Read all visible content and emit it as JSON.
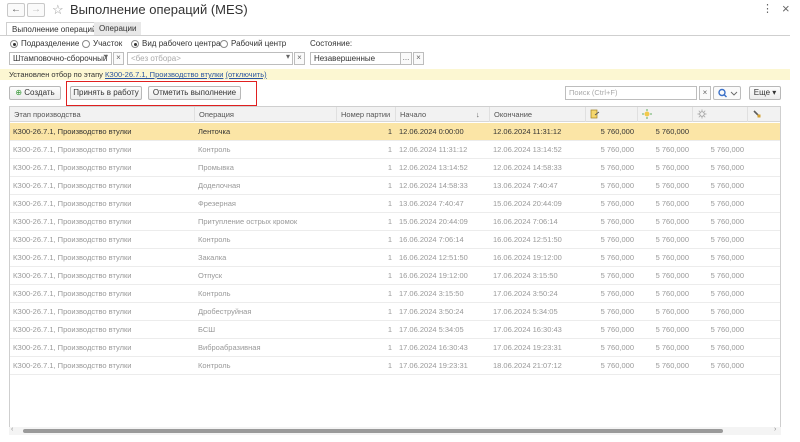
{
  "window": {
    "title": "Выполнение операций (MES)",
    "back": "←",
    "forward": "→",
    "star": "☆",
    "more": "⋮",
    "close": "×"
  },
  "tabs": [
    {
      "label": "Выполнение операций",
      "active": true
    },
    {
      "label": "Операции",
      "active": false
    }
  ],
  "filter": {
    "radios": [
      {
        "label": "Подразделение",
        "checked": true
      },
      {
        "label": "Участок",
        "checked": false
      },
      {
        "label": "Вид рабочего центра",
        "checked": true
      },
      {
        "label": "Рабочий центр",
        "checked": false
      }
    ],
    "subdivision_value": "Штамповочно-сборочный",
    "workcenter_placeholder": "<без отбора>",
    "state_label": "Состояние:",
    "state_value": "Незавершенные",
    "dropdown_glyph": "▾",
    "clear_glyph": "×",
    "select_glyph": "..."
  },
  "notice": {
    "prefix": "Установлен отбор по этапу ",
    "link": "КЗ00-26.7.1, Производство втулки",
    "suffix_link": "(отключить)"
  },
  "toolbar": {
    "create": "Создать",
    "accept": "Принять в работу",
    "mark_done": "Отметить выполнение",
    "search_placeholder": "Поиск (Ctrl+F)",
    "search_clear": "×",
    "search_icon": "magnifier-icon",
    "more": "Еще ▾"
  },
  "table": {
    "columns": [
      "Этап производства",
      "Операция",
      "Номер партии",
      "Начало",
      "Окончание"
    ],
    "sort_glyph": "↓",
    "icon_columns": [
      "document-icon",
      "add-star-icon",
      "gear-spark-icon",
      "tool-icon"
    ],
    "rows": [
      {
        "stage": "КЗ00-26.7.1, Производство втулки",
        "op": "Ленточка",
        "batch": "1",
        "start": "12.06.2024 0:00:00",
        "end": "12.06.2024 11:31:12",
        "v1": "5 760,000",
        "v2": "5 760,000",
        "v3": ""
      },
      {
        "stage": "КЗ00-26.7.1, Производство втулки",
        "op": "Контроль",
        "batch": "1",
        "start": "12.06.2024 11:31:12",
        "end": "12.06.2024 13:14:52",
        "v1": "5 760,000",
        "v2": "5 760,000",
        "v3": "5 760,000"
      },
      {
        "stage": "КЗ00-26.7.1, Производство втулки",
        "op": "Промывка",
        "batch": "1",
        "start": "12.06.2024 13:14:52",
        "end": "12.06.2024 14:58:33",
        "v1": "5 760,000",
        "v2": "5 760,000",
        "v3": "5 760,000"
      },
      {
        "stage": "КЗ00-26.7.1, Производство втулки",
        "op": "Доделочная",
        "batch": "1",
        "start": "12.06.2024 14:58:33",
        "end": "13.06.2024 7:40:47",
        "v1": "5 760,000",
        "v2": "5 760,000",
        "v3": "5 760,000"
      },
      {
        "stage": "КЗ00-26.7.1, Производство втулки",
        "op": "Фрезерная",
        "batch": "1",
        "start": "13.06.2024 7:40:47",
        "end": "15.06.2024 20:44:09",
        "v1": "5 760,000",
        "v2": "5 760,000",
        "v3": "5 760,000"
      },
      {
        "stage": "КЗ00-26.7.1, Производство втулки",
        "op": "Притупление острых кромок",
        "batch": "1",
        "start": "15.06.2024 20:44:09",
        "end": "16.06.2024 7:06:14",
        "v1": "5 760,000",
        "v2": "5 760,000",
        "v3": "5 760,000"
      },
      {
        "stage": "КЗ00-26.7.1, Производство втулки",
        "op": "Контроль",
        "batch": "1",
        "start": "16.06.2024 7:06:14",
        "end": "16.06.2024 12:51:50",
        "v1": "5 760,000",
        "v2": "5 760,000",
        "v3": "5 760,000"
      },
      {
        "stage": "КЗ00-26.7.1, Производство втулки",
        "op": "Закалка",
        "batch": "1",
        "start": "16.06.2024 12:51:50",
        "end": "16.06.2024 19:12:00",
        "v1": "5 760,000",
        "v2": "5 760,000",
        "v3": "5 760,000"
      },
      {
        "stage": "КЗ00-26.7.1, Производство втулки",
        "op": "Отпуск",
        "batch": "1",
        "start": "16.06.2024 19:12:00",
        "end": "17.06.2024 3:15:50",
        "v1": "5 760,000",
        "v2": "5 760,000",
        "v3": "5 760,000"
      },
      {
        "stage": "КЗ00-26.7.1, Производство втулки",
        "op": "Контроль",
        "batch": "1",
        "start": "17.06.2024 3:15:50",
        "end": "17.06.2024 3:50:24",
        "v1": "5 760,000",
        "v2": "5 760,000",
        "v3": "5 760,000"
      },
      {
        "stage": "КЗ00-26.7.1, Производство втулки",
        "op": "Дробеструйная",
        "batch": "1",
        "start": "17.06.2024 3:50:24",
        "end": "17.06.2024 5:34:05",
        "v1": "5 760,000",
        "v2": "5 760,000",
        "v3": "5 760,000"
      },
      {
        "stage": "КЗ00-26.7.1, Производство втулки",
        "op": "БСШ",
        "batch": "1",
        "start": "17.06.2024 5:34:05",
        "end": "17.06.2024 16:30:43",
        "v1": "5 760,000",
        "v2": "5 760,000",
        "v3": "5 760,000"
      },
      {
        "stage": "КЗ00-26.7.1, Производство втулки",
        "op": "Виброабразивная",
        "batch": "1",
        "start": "17.06.2024 16:30:43",
        "end": "17.06.2024 19:23:31",
        "v1": "5 760,000",
        "v2": "5 760,000",
        "v3": "5 760,000"
      },
      {
        "stage": "КЗ00-26.7.1, Производство втулки",
        "op": "Контроль",
        "batch": "1",
        "start": "17.06.2024 19:23:31",
        "end": "18.06.2024 21:07:12",
        "v1": "5 760,000",
        "v2": "5 760,000",
        "v3": "5 760,000"
      }
    ]
  },
  "colors": {
    "selected_row": "#fbe5a6",
    "notice_bg": "#fcf7d2",
    "highlight_box": "#e02020",
    "link": "#2a55a0"
  }
}
